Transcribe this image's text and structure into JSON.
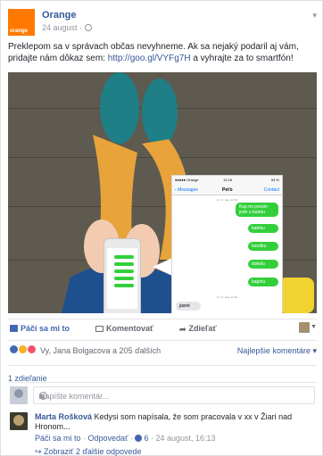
{
  "post": {
    "page_name": "Orange",
    "logo_text": "orange",
    "date": "24 august ·",
    "message_text": "Preklepom sa v správach občas nevyhneme. Ak sa nejaký podaril aj vám, pridajte nám dôkaz sem: ",
    "message_link": "http://goo.gl/VYFg7H",
    "message_tail": " a vyhrajte za to smartfón!"
  },
  "chat": {
    "carrier": "●●●●● Orange",
    "time": "12:18",
    "battery": "53 %",
    "back_label": "Messages",
    "contact_name": "Peťo",
    "contact_link": "Contact",
    "timestamp_1": "st, 17. aug. 12:15",
    "timestamp_2": "st, 17. aug. 12:18",
    "outgoing": [
      "Kup mi prosim jedn u batetu",
      "baleku",
      "bandku",
      "dokelu",
      "bagetu"
    ],
    "incoming": "jasné"
  },
  "actions": {
    "like": "Páči sa mi to",
    "comment": "Komentovať",
    "share": "Zdieľať"
  },
  "reactions": {
    "text": "Vy, Jana Bolgacova a 205 ďalších",
    "sort_label": "Najlepšie komentáre"
  },
  "comments_count": "1 zdieľanie",
  "composer": {
    "placeholder": "Napíšte komentár..."
  },
  "comment": {
    "author": "Marta Rošková",
    "text": " Kedysi som napísala, že som pracovala v xx v Žiari nad Hronom...",
    "like": "Páči sa mi to",
    "reply": "Odpovedať",
    "likes": "6",
    "date": "24 august, 16:13",
    "more_replies": "↪ Zobraziť 2 ďalšie odpovede"
  },
  "colors": {
    "brand": "#ff7900",
    "link": "#365899",
    "fb_blue": "#4267b2",
    "imessage_green": "#33cf3b"
  }
}
